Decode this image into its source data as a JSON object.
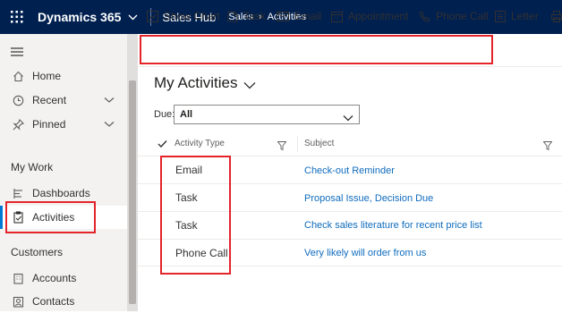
{
  "topbar": {
    "brand": "Dynamics 365",
    "app": "Sales Hub",
    "breadcrumb": [
      "Sales",
      "Activities"
    ]
  },
  "sidebar": {
    "items_top": [
      {
        "label": "Home",
        "icon": "home-icon"
      },
      {
        "label": "Recent",
        "icon": "clock-icon"
      },
      {
        "label": "Pinned",
        "icon": "pin-icon"
      }
    ],
    "section_mywork": "My Work",
    "items_mywork": [
      {
        "label": "Dashboards",
        "icon": "dashboard-icon"
      },
      {
        "label": "Activities",
        "icon": "clipboard-icon"
      }
    ],
    "section_customers": "Customers",
    "items_customers": [
      {
        "label": "Accounts",
        "icon": "building-icon"
      },
      {
        "label": "Contacts",
        "icon": "person-icon"
      }
    ]
  },
  "commands": [
    {
      "label": "Show Chart",
      "icon": "chart-icon"
    },
    {
      "label": "Task",
      "icon": "task-icon"
    },
    {
      "label": "Email",
      "icon": "email-icon"
    },
    {
      "label": "Appointment",
      "icon": "calendar-icon"
    },
    {
      "label": "Phone Call",
      "icon": "phone-icon"
    },
    {
      "label": "Letter",
      "icon": "letter-icon"
    }
  ],
  "view": {
    "title": "My Activities",
    "due_label": "Due:",
    "due_value": "All"
  },
  "grid": {
    "columns": [
      "Activity Type",
      "Subject"
    ],
    "rows": [
      {
        "type": "Email",
        "subject": "Check-out Reminder"
      },
      {
        "type": "Task",
        "subject": "Proposal Issue, Decision Due"
      },
      {
        "type": "Task",
        "subject": "Check sales literature for recent price list"
      },
      {
        "type": "Phone Call",
        "subject": "Very likely will order from us"
      }
    ]
  },
  "colors": {
    "nav_bg": "#002050",
    "highlight": "#e3242b",
    "link": "#0f6cbd",
    "accent": "#0078d4"
  }
}
